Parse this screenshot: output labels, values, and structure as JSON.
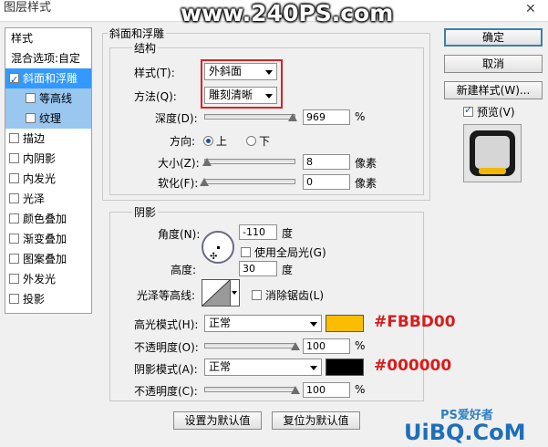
{
  "window": {
    "title": "图层样式",
    "watermark": "www.240PS.com",
    "close_glyph": "✕"
  },
  "style_list": {
    "header": "样式",
    "items": [
      {
        "label": "混合选项:自定",
        "checkbox": false,
        "checked": false
      },
      {
        "label": "斜面和浮雕",
        "checkbox": true,
        "checked": true,
        "selected": true
      },
      {
        "label": "等高线",
        "checkbox": true,
        "checked": false,
        "sub": true
      },
      {
        "label": "纹理",
        "checkbox": true,
        "checked": false,
        "sub": true
      },
      {
        "label": "描边",
        "checkbox": true,
        "checked": false
      },
      {
        "label": "内阴影",
        "checkbox": true,
        "checked": false
      },
      {
        "label": "内发光",
        "checkbox": true,
        "checked": false
      },
      {
        "label": "光泽",
        "checkbox": true,
        "checked": false
      },
      {
        "label": "颜色叠加",
        "checkbox": true,
        "checked": false
      },
      {
        "label": "渐变叠加",
        "checkbox": true,
        "checked": false
      },
      {
        "label": "图案叠加",
        "checkbox": true,
        "checked": false
      },
      {
        "label": "外发光",
        "checkbox": true,
        "checked": false
      },
      {
        "label": "投影",
        "checkbox": true,
        "checked": false
      }
    ]
  },
  "bevel": {
    "group_title": "斜面和浮雕",
    "structure_title": "结构",
    "style_label": "样式(T):",
    "style_value": "外斜面",
    "technique_label": "方法(Q):",
    "technique_value": "雕刻清晰",
    "depth_label": "深度(D):",
    "depth_value": "969",
    "depth_unit": "%",
    "depth_fraction": 0.97,
    "direction_label": "方向:",
    "direction_up": "上",
    "direction_down": "下",
    "size_label": "大小(Z):",
    "size_value": "8",
    "size_unit": "像素",
    "size_fraction": 0.03,
    "soften_label": "软化(F):",
    "soften_value": "0",
    "soften_unit": "像素",
    "soften_fraction": 0.0
  },
  "shading": {
    "title": "阴影",
    "angle_label": "角度(N):",
    "angle_value": "-110",
    "angle_unit": "度",
    "global_light_label": "使用全局光(G)",
    "altitude_label": "高度:",
    "altitude_value": "30",
    "altitude_unit": "度",
    "gloss_label": "光泽等高线:",
    "antialias_label": "消除锯齿(L)",
    "highlight_mode_label": "高光模式(H):",
    "highlight_mode_value": "正常",
    "highlight_color": "#FBBD00",
    "highlight_annotation": "#FBBD00",
    "highlight_opacity_label": "不透明度(O):",
    "highlight_opacity_value": "100",
    "highlight_opacity_unit": "%",
    "highlight_opacity_fraction": 1.0,
    "shadow_mode_label": "阴影模式(A):",
    "shadow_mode_value": "正常",
    "shadow_color": "#000000",
    "shadow_annotation": "#000000",
    "shadow_opacity_label": "不透明度(C):",
    "shadow_opacity_value": "100",
    "shadow_opacity_unit": "%",
    "shadow_opacity_fraction": 1.0
  },
  "footer": {
    "set_default": "设置为默认值",
    "reset_default": "复位为默认值"
  },
  "right": {
    "ok": "确定",
    "cancel": "取消",
    "new_style": "新建样式(W)...",
    "preview_label": "预览(V)",
    "preview_checked": true
  },
  "corner_watermark": {
    "ps_text": "PS爱好者",
    "site_text": "UiBQ.CoM"
  }
}
